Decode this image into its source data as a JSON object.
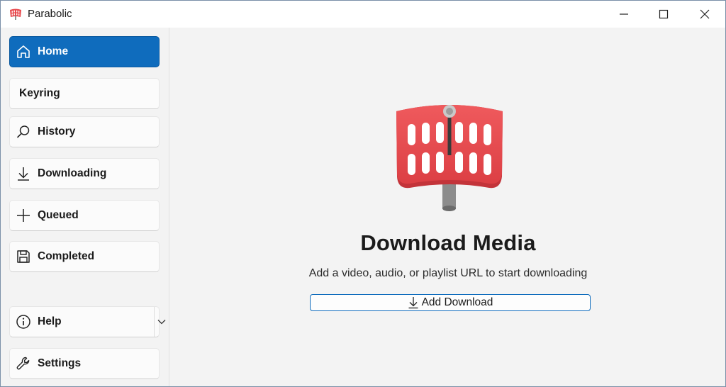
{
  "app": {
    "title": "Parabolic"
  },
  "window_controls": {
    "minimize": "minimize-icon",
    "maximize": "maximize-icon",
    "close": "close-icon"
  },
  "sidebar": {
    "items": [
      {
        "label": "Home",
        "icon": "home-icon",
        "active": true
      },
      {
        "label": "Keyring",
        "icon": "",
        "active": false
      },
      {
        "label": "History",
        "icon": "search-icon",
        "active": false
      },
      {
        "label": "Downloading",
        "icon": "download-arrow-icon",
        "active": false
      },
      {
        "label": "Queued",
        "icon": "plus-icon",
        "active": false
      },
      {
        "label": "Completed",
        "icon": "save-icon",
        "active": false
      }
    ],
    "footer": [
      {
        "label": "Help",
        "icon": "info-icon",
        "has_dropdown": true
      },
      {
        "label": "Settings",
        "icon": "wrench-icon"
      }
    ]
  },
  "main": {
    "heading": "Download Media",
    "subtext": "Add a video, audio, or playlist URL to start downloading",
    "add_button_label": "Add Download"
  },
  "colors": {
    "accent": "#0f6cbd",
    "logo_red": "#e8474b",
    "logo_red_dark": "#c92f35",
    "background": "#f3f3f3"
  }
}
